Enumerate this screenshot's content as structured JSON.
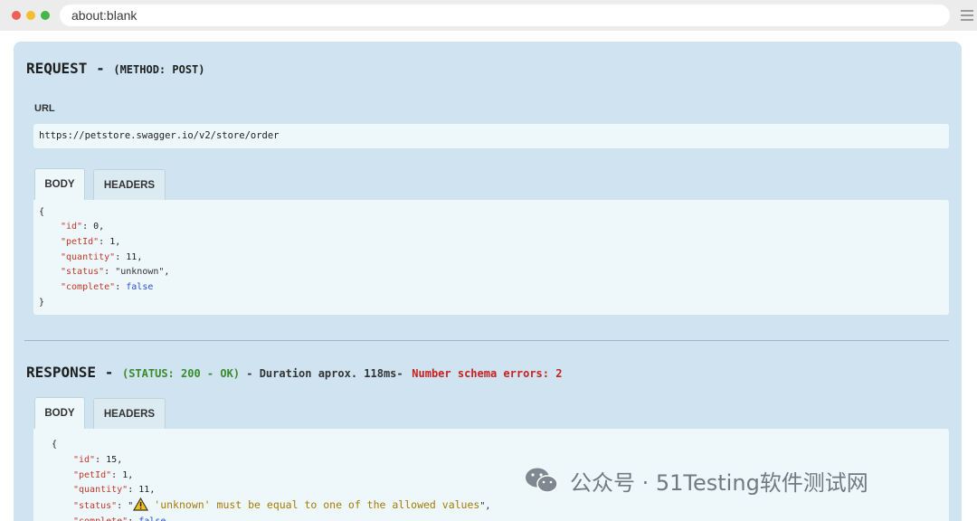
{
  "browser": {
    "url": "about:blank"
  },
  "request": {
    "title": "REQUEST -",
    "method": "(METHOD: POST)",
    "url_label": "URL",
    "url_value": "https://petstore.swagger.io/v2/store/order",
    "tabs": [
      "BODY",
      "HEADERS"
    ],
    "active_tab": "BODY",
    "body_lines": [
      {
        "text": "{"
      },
      {
        "key": "\"id\"",
        "value": "0",
        "sep": ","
      },
      {
        "key": "\"petId\"",
        "value": "1",
        "sep": ","
      },
      {
        "key": "\"quantity\"",
        "value": "11",
        "sep": ","
      },
      {
        "key": "\"status\"",
        "value": "\"unknown\"",
        "sep": ","
      },
      {
        "key": "\"complete\"",
        "value": "false",
        "sep": ""
      },
      {
        "text": "}"
      }
    ]
  },
  "response": {
    "title": "RESPONSE -",
    "status": "(STATUS: 200 - OK)",
    "duration": " - Duration aprox. 118ms-",
    "schema_errors": "Number schema errors: 2",
    "tabs": [
      "BODY",
      "HEADERS"
    ],
    "active_tab": "BODY",
    "body_lines": [
      {
        "text": "{"
      },
      {
        "key": "\"id\"",
        "value": "15",
        "sep": ","
      },
      {
        "key": "\"petId\"",
        "value": "1",
        "sep": ","
      },
      {
        "key": "\"quantity\"",
        "value": "11",
        "sep": ","
      },
      {
        "key": "\"status\"",
        "value_prefix": "\"",
        "warning": "'unknown' must be equal to one of the allowed values",
        "value_suffix": "\"",
        "sep": ","
      },
      {
        "key": "\"complete\"",
        "value": "false",
        "sep": ""
      }
    ]
  },
  "watermark": {
    "text": "公众号 · 51Testing软件测试网"
  },
  "colors": {
    "panel": "#cfe4f0",
    "field": "#eef8fb",
    "key": "#c0392b",
    "boolean": "#2b4ed8",
    "status_ok": "#3a8a2e",
    "error": "#c8201e",
    "warning": "#a57a0a"
  }
}
